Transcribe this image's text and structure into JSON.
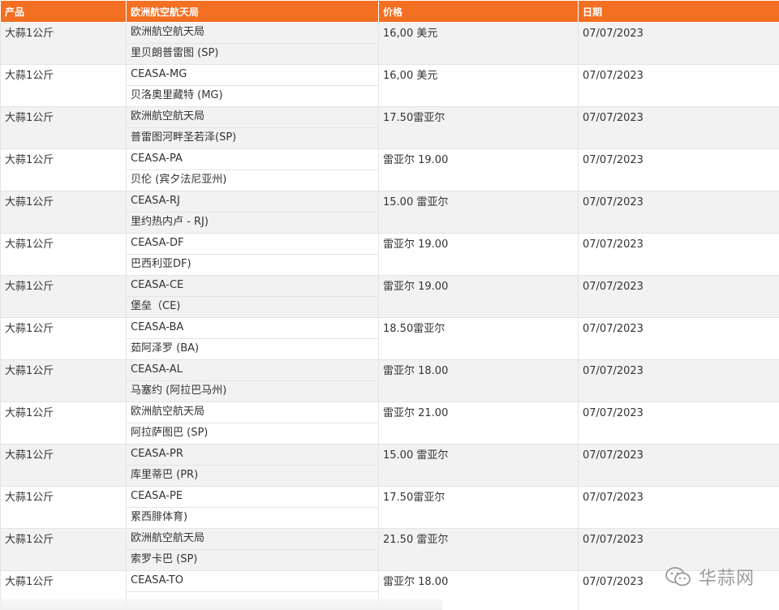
{
  "table": {
    "headers": {
      "product": "产品",
      "market": "欧洲航空航天局",
      "price": "价格",
      "date": "日期"
    },
    "rows": [
      {
        "product": "大蒜1公斤",
        "market": "欧洲航空航天局",
        "location": "里贝朗普雷图 (SP)",
        "price": "16,00 美元",
        "date": "07/07/2023"
      },
      {
        "product": "大蒜1公斤",
        "market": "CEASA-MG",
        "location": "贝洛奥里藏特 (MG)",
        "price": "16,00 美元",
        "date": "07/07/2023"
      },
      {
        "product": "大蒜1公斤",
        "market": "欧洲航空航天局",
        "location": "普雷图河畔圣若泽(SP)",
        "price": "17.50雷亚尔",
        "date": "07/07/2023"
      },
      {
        "product": "大蒜1公斤",
        "market": "CEASA-PA",
        "location": "贝伦 (宾夕法尼亚州)",
        "price": "雷亚尔 19.00",
        "date": "07/07/2023"
      },
      {
        "product": "大蒜1公斤",
        "market": "CEASA-RJ",
        "location": "里约热内卢 - RJ)",
        "price": "15.00 雷亚尔",
        "date": "07/07/2023"
      },
      {
        "product": "大蒜1公斤",
        "market": "CEASA-DF",
        "location": "巴西利亚DF)",
        "price": "雷亚尔 19.00",
        "date": "07/07/2023"
      },
      {
        "product": "大蒜1公斤",
        "market": "CEASA-CE",
        "location": "堡垒（CE)",
        "price": "雷亚尔 19.00",
        "date": "07/07/2023"
      },
      {
        "product": "大蒜1公斤",
        "market": "CEASA-BA",
        "location": "茹阿泽罗 (BA)",
        "price": "18.50雷亚尔",
        "date": "07/07/2023"
      },
      {
        "product": "大蒜1公斤",
        "market": "CEASA-AL",
        "location": "马塞约 (阿拉巴马州)",
        "price": "雷亚尔 18.00",
        "date": "07/07/2023"
      },
      {
        "product": "大蒜1公斤",
        "market": "欧洲航空航天局",
        "location": "阿拉萨图巴 (SP)",
        "price": "雷亚尔 21.00",
        "date": "07/07/2023"
      },
      {
        "product": "大蒜1公斤",
        "market": "CEASA-PR",
        "location": "库里蒂巴 (PR)",
        "price": "15.00 雷亚尔",
        "date": "07/07/2023"
      },
      {
        "product": "大蒜1公斤",
        "market": "CEASA-PE",
        "location": "累西腓体育)",
        "price": "17.50雷亚尔",
        "date": "07/07/2023"
      },
      {
        "product": "大蒜1公斤",
        "market": "欧洲航空航天局",
        "location": "索罗卡巴 (SP)",
        "price": "21.50 雷亚尔",
        "date": "07/07/2023"
      },
      {
        "product": "大蒜1公斤",
        "market": "CEASA-TO",
        "location": "",
        "price": "雷亚尔 18.00",
        "date": "07/07/2023"
      }
    ]
  },
  "watermark": {
    "text": "华蒜网",
    "icon": "wechat-icon"
  }
}
